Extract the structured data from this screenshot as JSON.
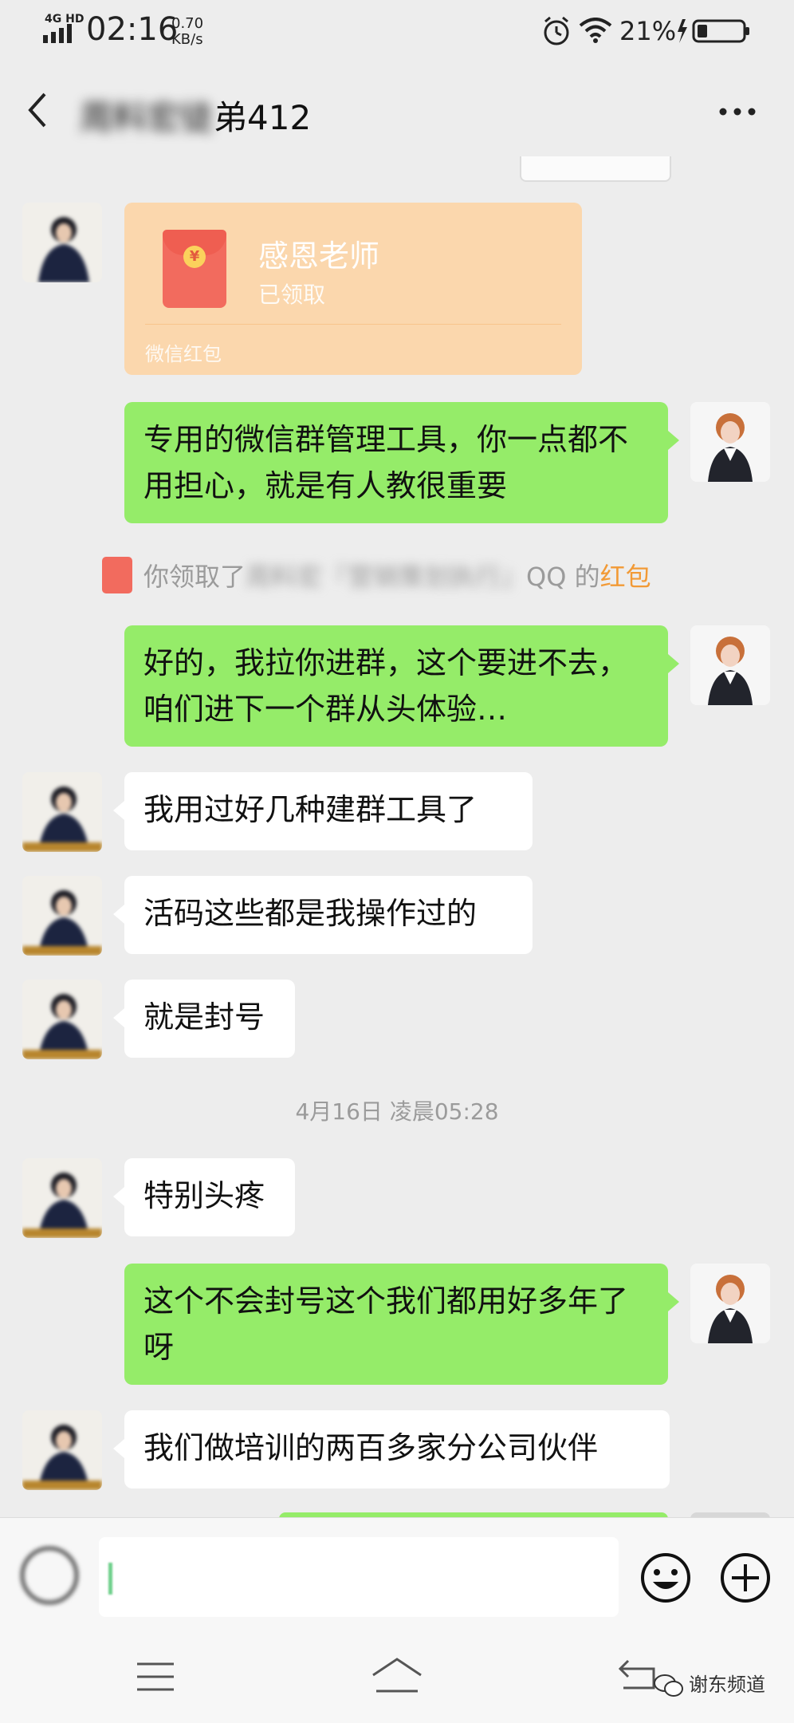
{
  "status_bar": {
    "network": "4G HD",
    "time": "02:16",
    "speed_value": "0.70",
    "speed_unit": "KB/s",
    "battery": "21%"
  },
  "header": {
    "title_blurred": "周料宏徒",
    "title_visible": "弟412",
    "more": "···"
  },
  "chat": {
    "red_packet": {
      "title": "感恩老师",
      "status": "已领取",
      "footer": "微信红包"
    },
    "system": {
      "prefix": "你领取了",
      "blurred": "周料宏『营销策划执行』",
      "mid": "QQ 的",
      "link": "红包"
    },
    "messages": [
      "专用的微信群管理工具，你一点都不用担心，就是有人教很重要",
      "好的，我拉你进群，这个要进不去，咱们进下一个群从头体验…",
      "我用过好几种建群工具了",
      "活码这些都是我操作过的",
      "就是封号",
      "特别头疼",
      "这个不会封号这个我们都用好多年了呀",
      "我们做培训的两百多家分公司伙伴"
    ],
    "timestamp": "4月16日 凌晨05:28"
  },
  "watermark": "谢东频道",
  "icons": [
    "back-icon",
    "more-icon",
    "voice-icon",
    "emoji-icon",
    "plus-icon",
    "menu-icon",
    "home-icon",
    "return-icon",
    "wechat-logo-icon"
  ],
  "colors": {
    "outgoing_bubble": "#95ec69",
    "incoming_bubble": "#ffffff",
    "red_packet": "#fbd7ad",
    "link": "#f29a36",
    "background": "#ededed"
  }
}
